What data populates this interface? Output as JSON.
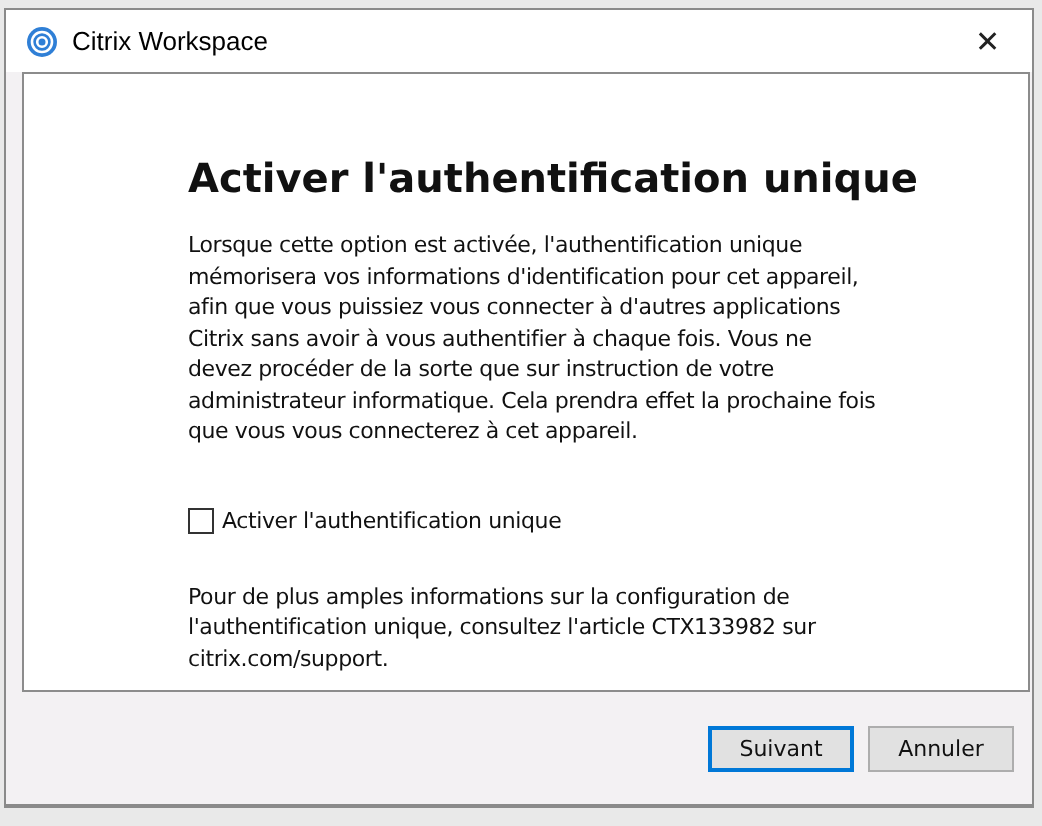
{
  "window": {
    "title": "Citrix Workspace",
    "close": "✕"
  },
  "heading": "Activer l'authentification unique",
  "description": "Lorsque cette option est activée, l'authentification unique mémorisera vos informations d'identification pour cet appareil, afin que vous puissiez vous connecter à d'autres applications Citrix sans avoir à vous authentifier à chaque fois. Vous ne devez procéder de la sorte que sur instruction de votre administrateur informatique. Cela prendra effet la prochaine fois que vous vous connecterez à cet appareil.",
  "option": {
    "label": "Activer l'authentification unique",
    "checked": false
  },
  "info": "Pour de plus amples informations sur la configuration de l'authentification unique, consultez l'article CTX133982 sur citrix.com/support.",
  "buttons": [
    {
      "label": "Suivant",
      "kind": "primary"
    },
    {
      "label": "Annuler",
      "kind": "secondary"
    }
  ]
}
